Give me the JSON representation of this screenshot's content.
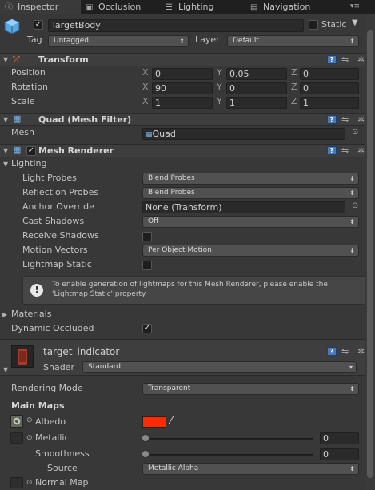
{
  "tabs": {
    "inspector": "Inspector",
    "occlusion": "Occlusion",
    "lighting": "Lighting",
    "navigation": "Navigation"
  },
  "object": {
    "name": "TargetBody",
    "static_label": "Static",
    "tag_label": "Tag",
    "tag_value": "Untagged",
    "layer_label": "Layer",
    "layer_value": "Default"
  },
  "transform": {
    "title": "Transform",
    "position": {
      "label": "Position",
      "x": "0",
      "y": "0.05",
      "z": "0"
    },
    "rotation": {
      "label": "Rotation",
      "x": "90",
      "y": "0",
      "z": "0"
    },
    "scale": {
      "label": "Scale",
      "x": "1",
      "y": "1",
      "z": "1"
    },
    "axis_x": "X",
    "axis_y": "Y",
    "axis_z": "Z"
  },
  "mesh_filter": {
    "title": "Quad (Mesh Filter)",
    "mesh_label": "Mesh",
    "mesh_value": "Quad"
  },
  "mesh_renderer": {
    "title": "Mesh Renderer",
    "lighting_label": "Lighting",
    "light_probes_label": "Light Probes",
    "light_probes_value": "Blend Probes",
    "reflection_probes_label": "Reflection Probes",
    "reflection_probes_value": "Blend Probes",
    "anchor_override_label": "Anchor Override",
    "anchor_override_value": "None (Transform)",
    "cast_shadows_label": "Cast Shadows",
    "cast_shadows_value": "Off",
    "receive_shadows_label": "Receive Shadows",
    "motion_vectors_label": "Motion Vectors",
    "motion_vectors_value": "Per Object Motion",
    "lightmap_static_label": "Lightmap Static",
    "help_line1": "To enable generation of lightmaps for this Mesh Renderer, please enable the",
    "help_line2": "'Lightmap Static' property.",
    "materials_label": "Materials",
    "dynamic_occluded_label": "Dynamic Occluded"
  },
  "material": {
    "name": "target_indicator",
    "shader_label": "Shader",
    "shader_value": "Standard",
    "rendering_mode_label": "Rendering Mode",
    "rendering_mode_value": "Transparent",
    "main_maps_label": "Main Maps",
    "albedo_label": "Albedo",
    "albedo_color": "#ff2a00",
    "metallic_label": "Metallic",
    "metallic_value": "0",
    "smoothness_label": "Smoothness",
    "smoothness_value": "0",
    "source_label": "Source",
    "source_value": "Metallic Alpha",
    "normal_map_label": "Normal Map"
  },
  "checks": {
    "static": false,
    "active": true,
    "mesh_renderer_enabled": true,
    "receive_shadows": false,
    "lightmap_static": false,
    "dynamic_occluded": true
  }
}
